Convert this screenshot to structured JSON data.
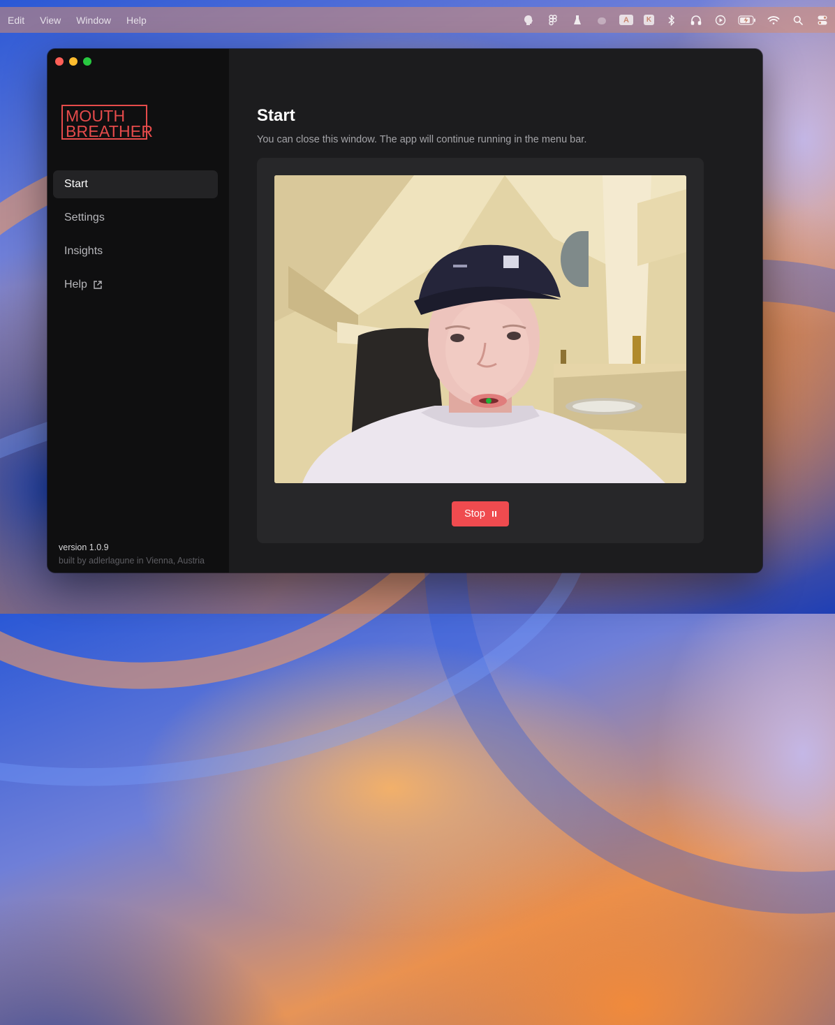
{
  "menubar": {
    "items": [
      "Edit",
      "View",
      "Window",
      "Help"
    ],
    "status_icons": [
      "mouth-breather-tray-icon",
      "figma-icon",
      "flask-icon",
      "paw-icon",
      "input-source-icon",
      "k-icon",
      "bluetooth-icon",
      "headphones-icon",
      "play-icon",
      "battery-icon",
      "wifi-icon",
      "search-icon",
      "control-center-icon"
    ],
    "input_source_label": "A",
    "k_label": "K"
  },
  "window": {
    "controls": [
      "close",
      "minimize",
      "maximize"
    ]
  },
  "sidebar": {
    "logo_line1": "MOUTH",
    "logo_line2": "BREATHER",
    "nav": [
      {
        "label": "Start",
        "active": true
      },
      {
        "label": "Settings",
        "active": false
      },
      {
        "label": "Insights",
        "active": false
      },
      {
        "label": "Help",
        "active": false,
        "external": true
      }
    ],
    "version": "version 1.0.9",
    "credit": "built by adlerlagune in Vienna, Austria"
  },
  "main": {
    "title": "Start",
    "subtitle": "You can close this window. The app will continue running in the menu bar.",
    "stop_label": "Stop"
  },
  "colors": {
    "accent": "#ef4b4f",
    "logo": "#e64b4b",
    "sidebar_bg": "#0f0f10",
    "main_bg": "#1c1c1e",
    "panel_bg": "#272729",
    "mouth_marker": "#1fb53a"
  }
}
